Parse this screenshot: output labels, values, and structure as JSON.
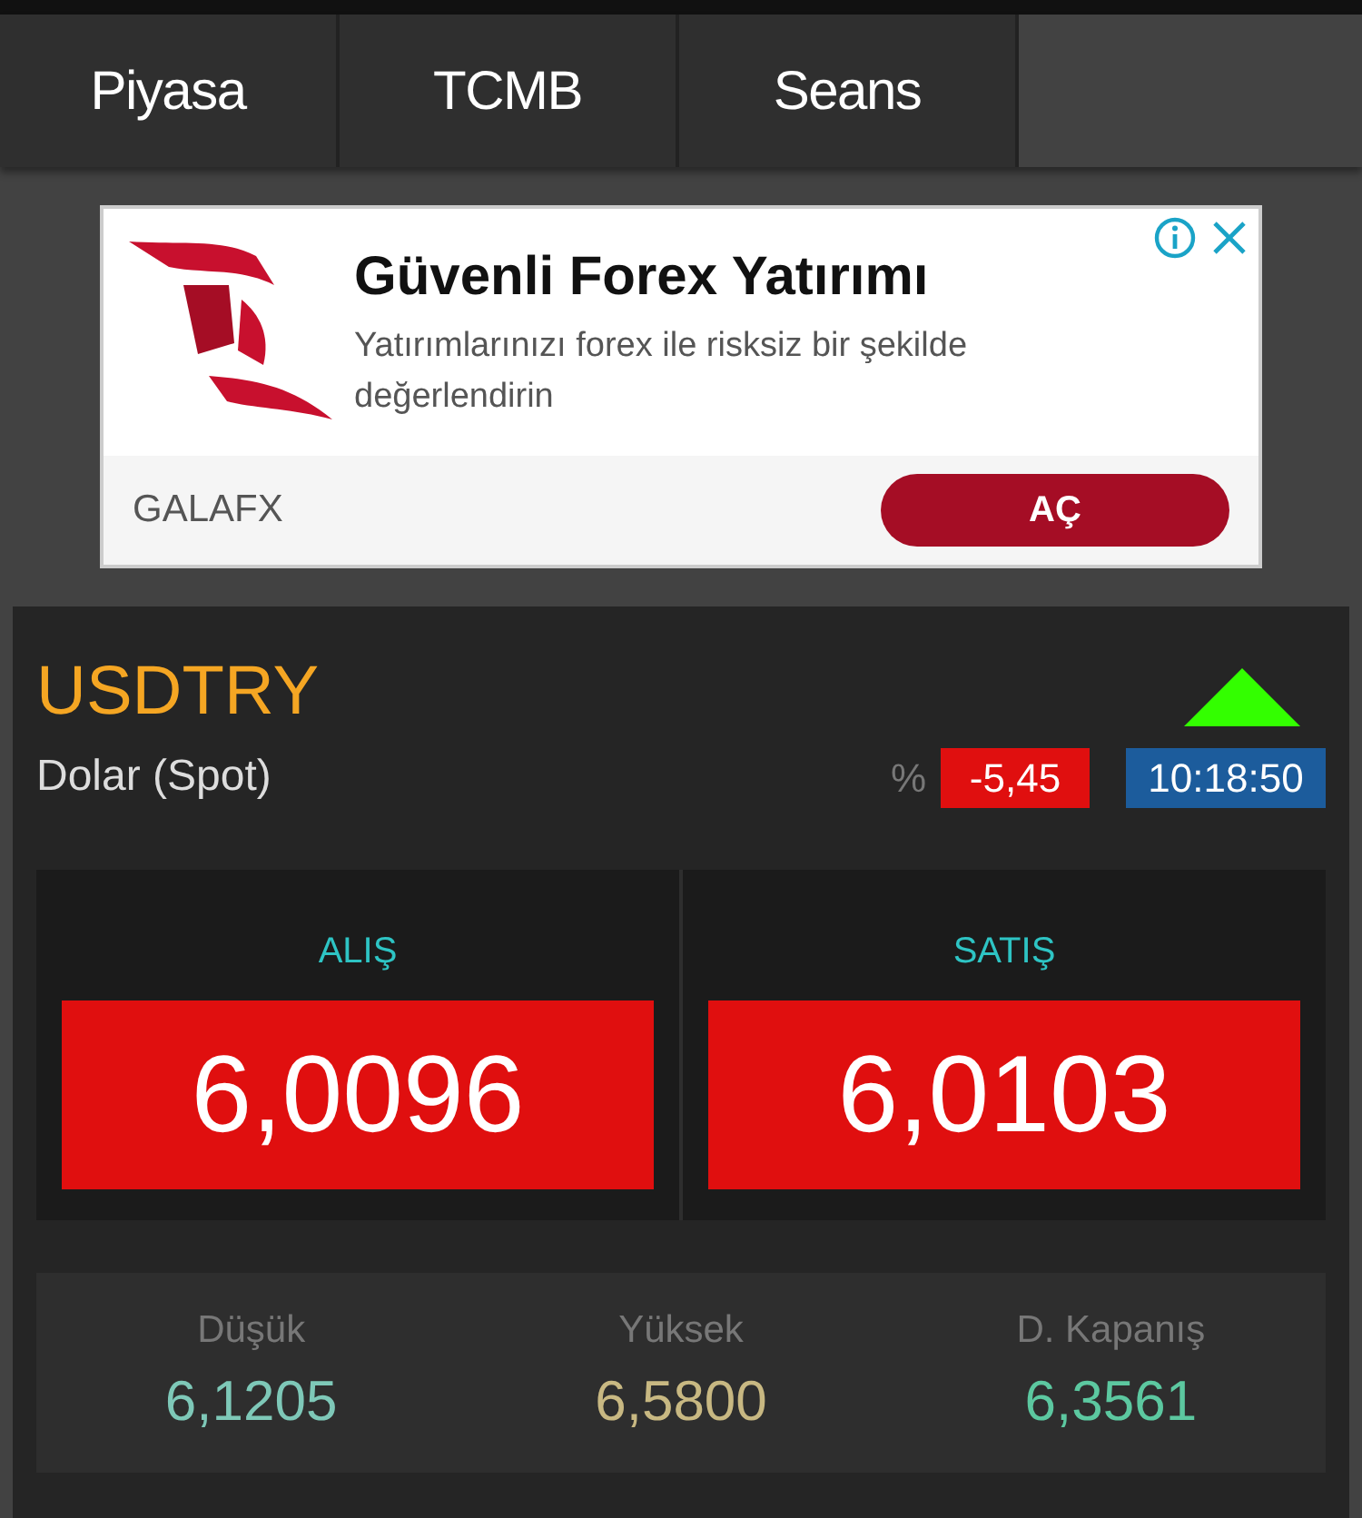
{
  "tabs": [
    {
      "label": "Piyasa",
      "selected": false
    },
    {
      "label": "TCMB",
      "selected": false
    },
    {
      "label": "Seans",
      "selected": false
    }
  ],
  "ad": {
    "title": "Güvenli Forex Yatırımı",
    "description": "Yatırımlarınızı forex ile risksiz bir şekilde değerlendirin",
    "advertiser": "GALAFX",
    "button": "AÇ"
  },
  "quote": {
    "symbol": "USDTRY",
    "name": "Dolar (Spot)",
    "rising": true,
    "percent_label": "%",
    "change": "-5,45",
    "time": "10:18:50",
    "prices": [
      {
        "label": "ALIŞ",
        "value": "6,0096"
      },
      {
        "label": "SATIŞ",
        "value": "6,0103"
      }
    ],
    "stats": [
      {
        "label": "Düşük",
        "value": "6,1205",
        "color": "#7ec8b8"
      },
      {
        "label": "Yüksek",
        "value": "6,5800",
        "color": "#c8b882"
      },
      {
        "label": "D. Kapanış",
        "value": "6,3561",
        "color": "#5cc8a0"
      }
    ]
  }
}
